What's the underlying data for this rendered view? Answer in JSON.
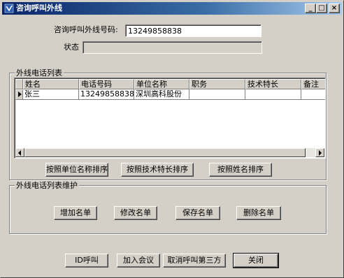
{
  "window": {
    "title": "咨询呼叫外线",
    "minimize": "_",
    "maximize": "□",
    "close": "×"
  },
  "form": {
    "phone_label": "咨询呼叫外线号码:",
    "phone_value": "13249858838",
    "status_label": "状态",
    "status_value": ""
  },
  "list_group": {
    "title": "外线电话列表",
    "columns": [
      "姓名",
      "电话号码",
      "单位名称",
      "职务",
      "技术特长",
      "备注"
    ],
    "rows": [
      [
        "张三",
        "13249858838",
        "深圳高科股份",
        "",
        "",
        ""
      ]
    ]
  },
  "sort_buttons": {
    "by_company": "按照单位名称排序",
    "by_skill": "按照技术特长排序",
    "by_name": "按照姓名排序"
  },
  "maintain_group": {
    "title": "外线电话列表维护",
    "add": "增加名单",
    "edit": "修改名单",
    "save": "保存名单",
    "delete": "删除名单"
  },
  "bottom_buttons": {
    "call": "ID呼叫",
    "join": "加入会议",
    "cancel_third": "取消呼叫第三方",
    "close": "关闭"
  },
  "colors": {
    "titlebar_start": "#0a246a",
    "titlebar_end": "#a6caf0",
    "face": "#d4d0c8"
  }
}
